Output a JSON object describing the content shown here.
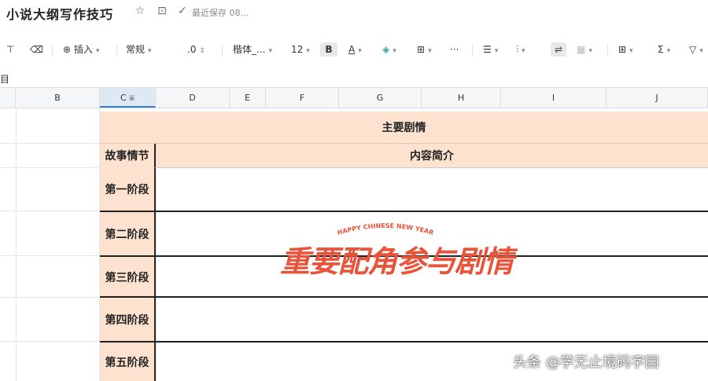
{
  "doc": {
    "title": "小说大纲写作技巧",
    "save_status": "最近保存 08..."
  },
  "toolbar": {
    "insert_label": "插入",
    "format_label": "常规",
    "decimal_label": ".0",
    "font_label": "楷体_...",
    "size_label": "12",
    "bold_label": "B",
    "text_color_label": "A",
    "more_label": "···"
  },
  "formula_bar": {
    "cell_ref": "目"
  },
  "columns": [
    "B",
    "C",
    "D",
    "E",
    "F",
    "G",
    "H",
    "I",
    "J"
  ],
  "sheet": {
    "merged_title": "主要剧情",
    "header_left": "故事情节",
    "header_right": "内容简介",
    "stages": [
      "第一阶段",
      "第二阶段",
      "第三阶段",
      "第四阶段",
      "第五阶段"
    ]
  },
  "watermark": {
    "sub": "HAPPY CHINESE NEW YEAR",
    "main": "重要配角参与剧情"
  },
  "credit": "头条 @学无止境码字园",
  "colors": {
    "header_fill": "#fde3cf",
    "watermark": "#e8533a",
    "accent": "#3a7bd5"
  }
}
